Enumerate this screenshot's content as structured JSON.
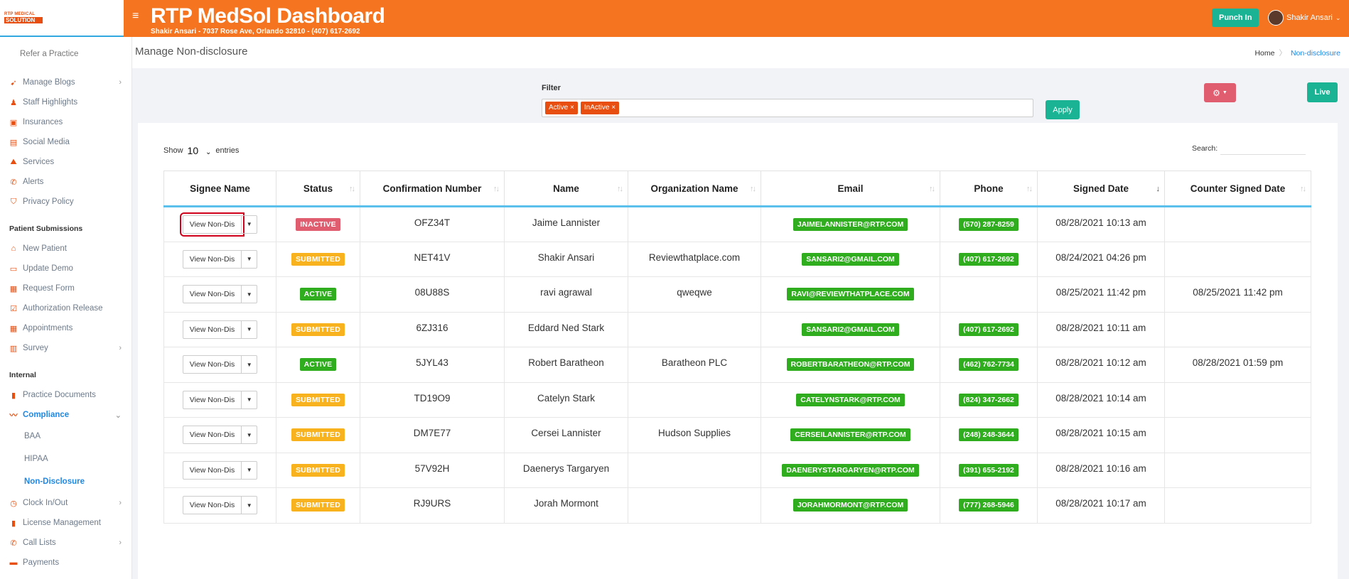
{
  "app": {
    "logo_line1": "RTP MEDICAL",
    "logo_line2": "SOLUTION",
    "title": "RTP MedSol Dashboard",
    "subtitle": "Shakir Ansari - 7037 Rose Ave, Orlando 32810 - (407) 617-2692",
    "punch_label": "Punch In",
    "user_name": "Shakir Ansari"
  },
  "sidebar": {
    "refer": "Refer a Practice",
    "group1": [
      {
        "label": "Manage Blogs",
        "icon": "blog-icon",
        "chev": true
      },
      {
        "label": "Staff Highlights",
        "icon": "staff-icon",
        "chev": false
      },
      {
        "label": "Insurances",
        "icon": "briefcase-icon",
        "chev": false
      },
      {
        "label": "Social Media",
        "icon": "social-icon",
        "chev": false
      },
      {
        "label": "Services",
        "icon": "services-icon",
        "chev": false
      },
      {
        "label": "Alerts",
        "icon": "phone-icon",
        "chev": false
      },
      {
        "label": "Privacy Policy",
        "icon": "shield-icon",
        "chev": false
      }
    ],
    "header_patient": "Patient Submissions",
    "group2": [
      {
        "label": "New Patient",
        "icon": "home-icon",
        "chev": false
      },
      {
        "label": "Update Demo",
        "icon": "id-card-icon",
        "chev": false
      },
      {
        "label": "Request Form",
        "icon": "form-icon",
        "chev": false
      },
      {
        "label": "Authorization Release",
        "icon": "check-icon",
        "chev": false
      },
      {
        "label": "Appointments",
        "icon": "calendar-icon",
        "chev": false
      },
      {
        "label": "Survey",
        "icon": "survey-icon",
        "chev": true
      }
    ],
    "header_internal": "Internal",
    "practice_documents": "Practice Documents",
    "compliance": "Compliance",
    "compliance_sub": [
      "BAA",
      "HIPAA",
      "Non-Disclosure"
    ],
    "group3": [
      {
        "label": "Clock In/Out",
        "icon": "clock-icon",
        "chev": true
      },
      {
        "label": "License Management",
        "icon": "license-icon",
        "chev": false
      },
      {
        "label": "Call Lists",
        "icon": "phone-icon",
        "chev": true
      },
      {
        "label": "Payments",
        "icon": "payment-icon",
        "chev": false
      }
    ]
  },
  "page": {
    "title": "Manage Non-disclosure",
    "breadcrumb_home": "Home",
    "breadcrumb_current": "Non-disclosure"
  },
  "filter": {
    "label": "Filter",
    "tags": [
      "Active",
      "InActive"
    ],
    "apply": "Apply",
    "live": "Live"
  },
  "table_controls": {
    "show": "Show",
    "entries_value": "10",
    "entries": "entries",
    "search": "Search:"
  },
  "table": {
    "columns": [
      "Signee Name",
      "Status",
      "Confirmation Number",
      "Name",
      "Organization Name",
      "Email",
      "Phone",
      "Signed Date",
      "Counter Signed Date"
    ],
    "view_label": "View Non-Dis",
    "rows": [
      {
        "status": "INACTIVE",
        "status_color": "#e05d6f",
        "conf": "OFZ34T",
        "name": "Jaime Lannister",
        "org": "",
        "email": "JAIMELANNISTER@RTP.COM",
        "phone": "(570) 287-8259",
        "signed": "08/28/2021 10:13 am",
        "counter": ""
      },
      {
        "status": "SUBMITTED",
        "status_color": "#f7b21e",
        "conf": "NET41V",
        "name": "Shakir Ansari",
        "org": "Reviewthatplace.com",
        "email": "SANSARI2@GMAIL.COM",
        "phone": "(407) 617-2692",
        "signed": "08/24/2021 04:26 pm",
        "counter": ""
      },
      {
        "status": "ACTIVE",
        "status_color": "#2fad1f",
        "conf": "08U88S",
        "name": "ravi agrawal",
        "org": "qweqwe",
        "email": "RAVI@REVIEWTHATPLACE.COM",
        "phone": "",
        "signed": "08/25/2021 11:42 pm",
        "counter": "08/25/2021 11:42 pm"
      },
      {
        "status": "SUBMITTED",
        "status_color": "#f7b21e",
        "conf": "6ZJ316",
        "name": "Eddard Ned Stark",
        "org": "",
        "email": "SANSARI2@GMAIL.COM",
        "phone": "(407) 617-2692",
        "signed": "08/28/2021 10:11 am",
        "counter": ""
      },
      {
        "status": "ACTIVE",
        "status_color": "#2fad1f",
        "conf": "5JYL43",
        "name": "Robert Baratheon",
        "org": "Baratheon PLC",
        "email": "ROBERTBARATHEON@RTP.COM",
        "phone": "(462) 762-7734",
        "signed": "08/28/2021 10:12 am",
        "counter": "08/28/2021 01:59 pm"
      },
      {
        "status": "SUBMITTED",
        "status_color": "#f7b21e",
        "conf": "TD19O9",
        "name": "Catelyn Stark",
        "org": "",
        "email": "CATELYNSTARK@RTP.COM",
        "phone": "(824) 347-2662",
        "signed": "08/28/2021 10:14 am",
        "counter": ""
      },
      {
        "status": "SUBMITTED",
        "status_color": "#f7b21e",
        "conf": "DM7E77",
        "name": "Cersei Lannister",
        "org": "Hudson Supplies",
        "email": "CERSEILANNISTER@RTP.COM",
        "phone": "(248) 248-3644",
        "signed": "08/28/2021 10:15 am",
        "counter": ""
      },
      {
        "status": "SUBMITTED",
        "status_color": "#f7b21e",
        "conf": "57V92H",
        "name": "Daenerys Targaryen",
        "org": "",
        "email": "DAENERYSTARGARYEN@RTP.COM",
        "phone": "(391) 655-2192",
        "signed": "08/28/2021 10:16 am",
        "counter": ""
      },
      {
        "status": "SUBMITTED",
        "status_color": "#f7b21e",
        "conf": "RJ9URS",
        "name": "Jorah Mormont",
        "org": "",
        "email": "JORAHMORMONT@RTP.COM",
        "phone": "(777) 268-5946",
        "signed": "08/28/2021 10:17 am",
        "counter": ""
      }
    ]
  }
}
